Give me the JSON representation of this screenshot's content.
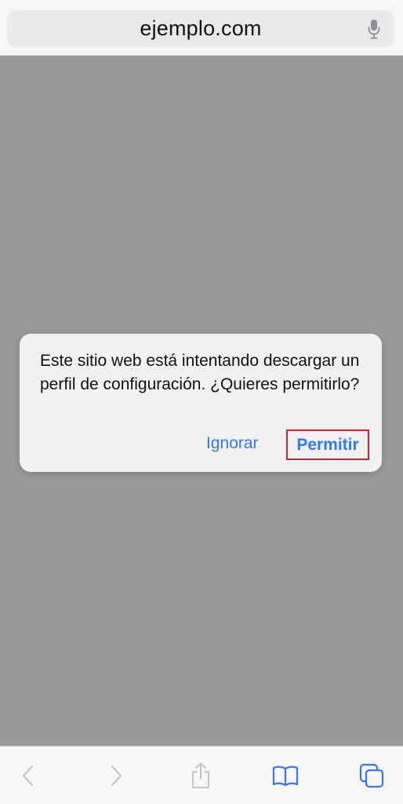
{
  "browser": {
    "url": "ejemplo.com",
    "mic_icon": "microphone-icon"
  },
  "dialog": {
    "message": "Este sitio web está intentando descargar un perfil de configuración. ¿Quieres permitirlo?",
    "ignore_label": "Ignorar",
    "allow_label": "Permitir"
  },
  "toolbar": {
    "icons": [
      "back-icon",
      "forward-icon",
      "share-icon",
      "bookmarks-icon",
      "tabs-icon"
    ]
  },
  "colors": {
    "accent": "#3478f6",
    "highlight_border": "#e11d2e",
    "overlay": "#9a9a9a",
    "dialog_bg": "#f1f1f3"
  }
}
